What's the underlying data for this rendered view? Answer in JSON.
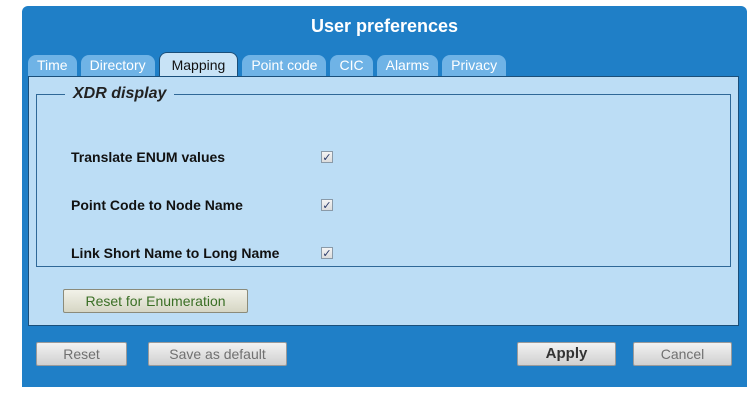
{
  "dialog": {
    "title": "User preferences"
  },
  "tabs": [
    {
      "label": "Time"
    },
    {
      "label": "Directory"
    },
    {
      "label": "Mapping"
    },
    {
      "label": "Point code"
    },
    {
      "label": "CIC"
    },
    {
      "label": "Alarms"
    },
    {
      "label": "Privacy"
    }
  ],
  "active_tab": "Mapping",
  "panel": {
    "legend": "XDR display",
    "options": [
      {
        "label": "Translate ENUM values",
        "checked": true
      },
      {
        "label": "Point Code to Node Name",
        "checked": true
      },
      {
        "label": "Link Short Name to Long Name",
        "checked": true
      }
    ],
    "reset_enum_label": "Reset for Enumeration"
  },
  "footer": {
    "reset_label": "Reset",
    "save_default_label": "Save as default",
    "apply_label": "Apply",
    "cancel_label": "Cancel"
  },
  "colors": {
    "dialog_bg": "#1f7fc7",
    "tab_inactive": "#6fb3e6",
    "tab_active": "#c8e3f6",
    "panel_bg": "#bcddf5"
  }
}
